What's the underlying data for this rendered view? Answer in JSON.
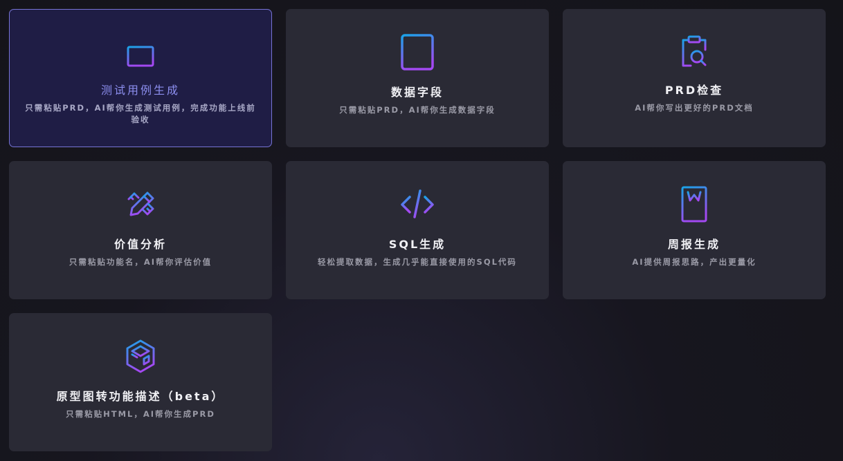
{
  "accent": {
    "cyan": "#1aa3e8",
    "purple": "#a349f2",
    "active_border": "#7774d6",
    "active_title": "#8d8ff0"
  },
  "cards": [
    {
      "icon": "stack-icon",
      "title": "测试用例生成",
      "desc": "只需粘贴PRD，AI帮你生成测试用例，完成功能上线前验收",
      "active": true
    },
    {
      "icon": "table-icon",
      "title": "数据字段",
      "desc": "只需粘贴PRD，AI帮你生成数据字段",
      "active": false
    },
    {
      "icon": "clipboard-search-icon",
      "title": "PRD检查",
      "desc": "AI帮你写出更好的PRD文档",
      "active": false
    },
    {
      "icon": "pencil-ruler-icon",
      "title": "价值分析",
      "desc": "只需粘贴功能名，AI帮你评估价值",
      "active": false
    },
    {
      "icon": "code-icon",
      "title": "SQL生成",
      "desc": "轻松提取数据，生成几乎能直接使用的SQL代码",
      "active": false
    },
    {
      "icon": "word-document-icon",
      "title": "周报生成",
      "desc": "AI提供周报思路，产出更量化",
      "active": false
    },
    {
      "icon": "cube-icon",
      "title": "原型图转功能描述（beta）",
      "desc": "只需粘贴HTML，AI帮你生成PRD",
      "active": false
    }
  ]
}
